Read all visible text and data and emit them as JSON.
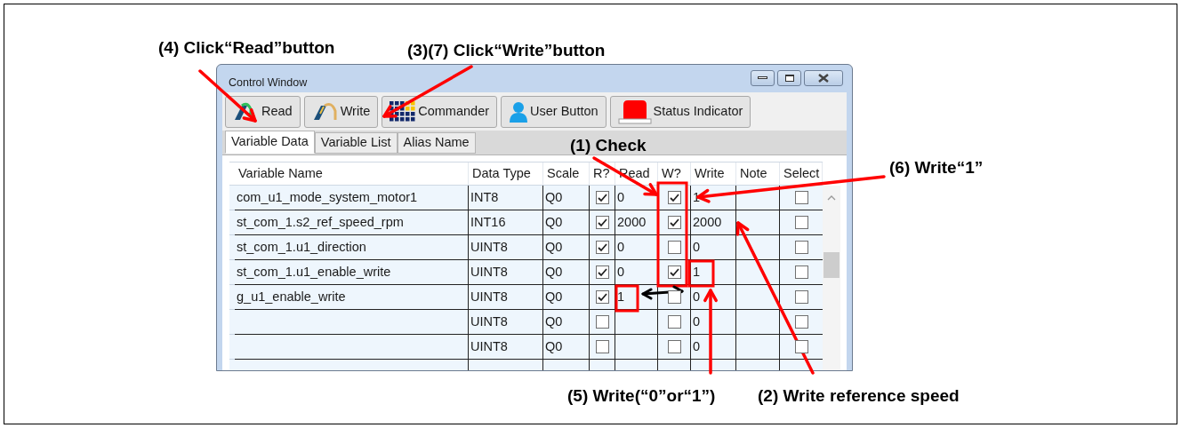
{
  "callouts": [
    {
      "text": "(4) Click“Read”button"
    },
    {
      "text": "(3)(7) Click“Write”button"
    },
    {
      "text": "(1) Check"
    },
    {
      "text": "(6) Write“1”"
    },
    {
      "text": "(5) Write(“0”or“1”)"
    },
    {
      "text": "(2) Write reference speed"
    }
  ],
  "window": {
    "title": "Control Window",
    "controls": [
      {
        "kind": "minimize"
      },
      {
        "kind": "maximize"
      },
      {
        "kind": "close"
      }
    ]
  },
  "toolbar": [
    {
      "label": "Read",
      "kind": "read"
    },
    {
      "label": "Write",
      "kind": "write"
    },
    {
      "label": "Commander",
      "kind": "commander"
    },
    {
      "label": "User Button",
      "kind": "user"
    },
    {
      "label": "Status Indicator",
      "kind": "status"
    }
  ],
  "tabs": [
    {
      "label": "Variable Data",
      "selected": true
    },
    {
      "label": "Variable List",
      "selected": false
    },
    {
      "label": "Alias Name",
      "selected": false
    }
  ],
  "table": {
    "columns": [
      "Variable Name",
      "Data Type",
      "Scale",
      "R?",
      "Read",
      "W?",
      "Write",
      "Note",
      "Select"
    ],
    "rows": [
      {
        "variable_name": "com_u1_mode_system_motor1",
        "data_type": "INT8",
        "scale": "Q0",
        "r_checked": true,
        "read": "0",
        "w_checked": true,
        "write": "1",
        "select_checked": false
      },
      {
        "variable_name": "st_com_1.s2_ref_speed_rpm",
        "data_type": "INT16",
        "scale": "Q0",
        "r_checked": true,
        "read": "2000",
        "w_checked": true,
        "write": "2000",
        "select_checked": false
      },
      {
        "variable_name": "st_com_1.u1_direction",
        "data_type": "UINT8",
        "scale": "Q0",
        "r_checked": true,
        "read": "0",
        "w_checked": false,
        "write": "0",
        "select_checked": false
      },
      {
        "variable_name": "st_com_1.u1_enable_write",
        "data_type": "UINT8",
        "scale": "Q0",
        "r_checked": true,
        "read": "0",
        "w_checked": true,
        "write": "1",
        "select_checked": false
      },
      {
        "variable_name": "g_u1_enable_write",
        "data_type": "UINT8",
        "scale": "Q0",
        "r_checked": true,
        "read": "1",
        "w_checked": false,
        "write": "0",
        "select_checked": false
      },
      {
        "data_type": "UINT8",
        "scale": "Q0",
        "r_checked": false,
        "w_checked": false,
        "write": "0",
        "select_checked": false
      },
      {
        "data_type": "UINT8",
        "scale": "Q0",
        "r_checked": false,
        "w_checked": false,
        "write": "0",
        "select_checked": false
      }
    ]
  }
}
